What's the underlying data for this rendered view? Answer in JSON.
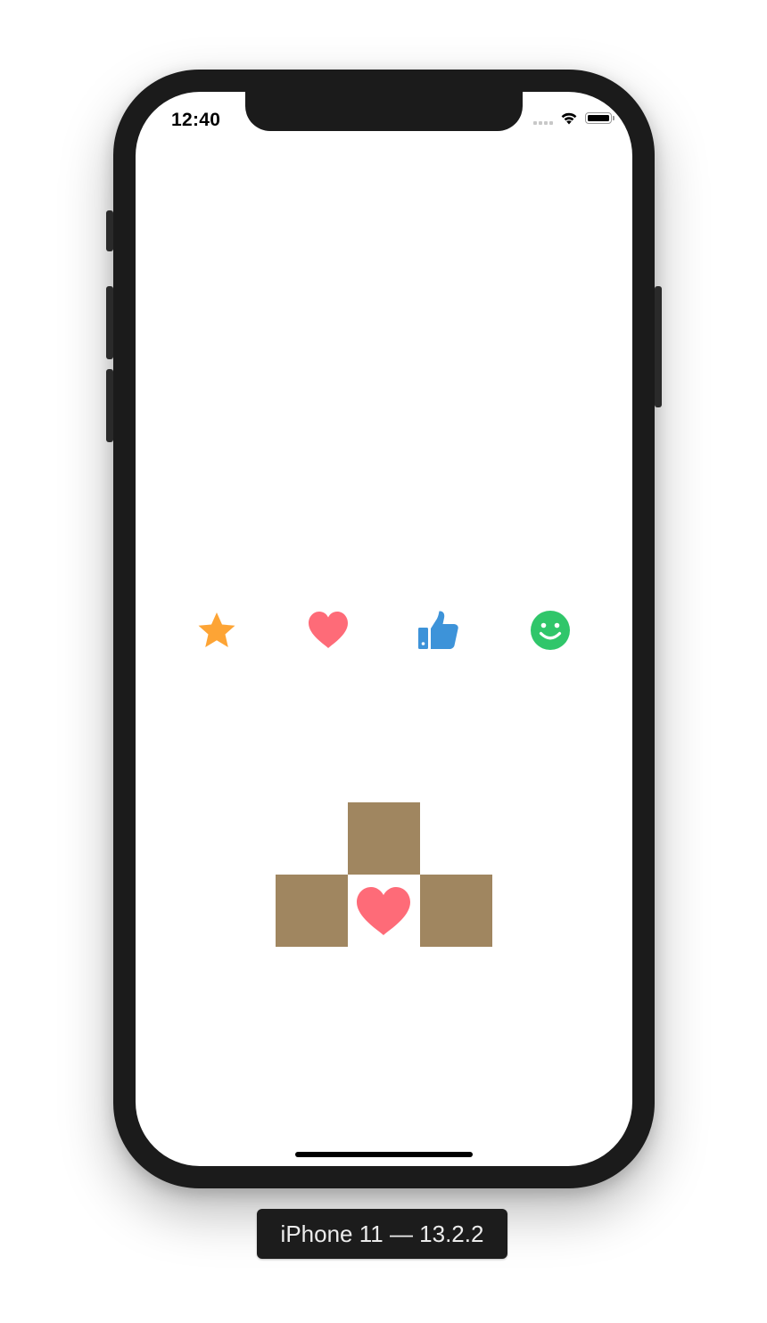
{
  "status_bar": {
    "time": "12:40"
  },
  "reaction_icons": [
    {
      "name": "star-icon",
      "color": "#fda435"
    },
    {
      "name": "heart-icon",
      "color": "#fe6b78"
    },
    {
      "name": "thumbs-up-icon",
      "color": "#3d93d9"
    },
    {
      "name": "smiley-icon",
      "color": "#30c66a"
    }
  ],
  "box_cluster": {
    "box_color": "#a08660",
    "center_icon": "heart-icon",
    "center_icon_color": "#fe6b78"
  },
  "device_label": "iPhone 11 — 13.2.2"
}
